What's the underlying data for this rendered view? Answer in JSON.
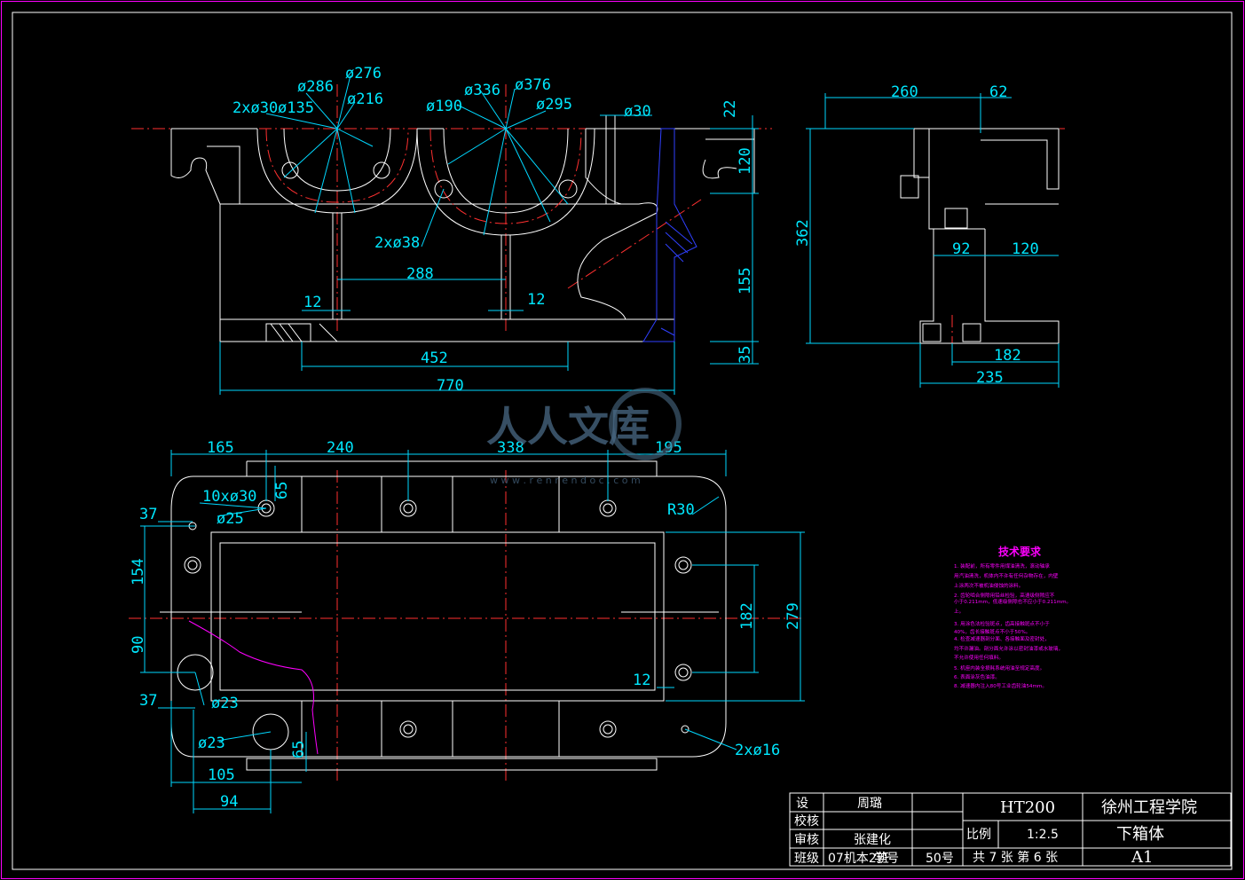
{
  "dims": {
    "d286": "ø286",
    "d276": "ø276",
    "d216": "ø216",
    "d2x30": "2xø30",
    "d135": "ø135",
    "d336": "ø336",
    "d376": "ø376",
    "d190": "ø190",
    "d295": "ø295",
    "d30": "ø30",
    "d22": "22",
    "d120a": "120",
    "d2x38": "2xø38",
    "d288": "288",
    "d12a": "12",
    "d12b": "12",
    "d155": "155",
    "d452": "452",
    "d35": "35",
    "d770": "770",
    "d260": "260",
    "d62": "62",
    "d362": "362",
    "d92": "92",
    "d120b": "120",
    "d182a": "182",
    "d235": "235",
    "d165": "165",
    "d240": "240",
    "d338": "338",
    "d195": "195",
    "d10x30": "10xø30",
    "d65a": "65",
    "d25": "ø25",
    "d37a": "37",
    "d154": "154",
    "d90": "90",
    "d37b": "37",
    "d23a": "ø23",
    "d23b": "ø23",
    "d65b": "65",
    "d105": "105",
    "d94": "94",
    "dR30": "R30",
    "d182b": "182",
    "d279": "279",
    "d12c": "12",
    "d2x16": "2xø16"
  },
  "tech": {
    "title": "技术要求",
    "lines": [
      "1. 装配前，所有零件用煤油清洗，滚动轴承",
      "用汽油清洗，机体内不许有任何杂物存在，内壁",
      "上涂两次不被机油侵蚀的涂料。",
      "2. 齿轮啮合侧隙用铅丝检验，高速级侧隙应不",
      "小于0.211mm，低速级侧隙也不应小于0.211mm。",
      "上。",
      "3. 用涂色法检验斑点，齿高接触斑点不小于",
      "40%，齿长接触斑点不小于50%。",
      "4. 检查减速器剖分面、各接触面及密封处，",
      "均不许漏油。剖分面允许涂以密封油漆或水玻璃，",
      "不允许使用任何填料。",
      "5. 机座内装全损耗系统用油至规定高度。",
      "6. 表面涂灰色油漆。",
      "8. 减速器内注入80号工业齿轮油54mm。"
    ]
  },
  "title_block": {
    "design_label": "设",
    "design_name": "周璐",
    "check_label": "校核",
    "review_label": "审核",
    "review_name": "张建化",
    "class_label": "班级",
    "class_value": "07机本2班",
    "student_no_label": "学号",
    "student_no": "50号",
    "material": "HT200",
    "scale_label": "比例",
    "scale_value": "1:2.5",
    "sheet_info": "共 7 张  第 6 张",
    "school": "徐州工程学院",
    "part_name": "下箱体",
    "size": "A1"
  },
  "watermark": {
    "text": "人人文库",
    "sub": "w w w . r e n r e n d o c . c o m"
  },
  "colors": {
    "frame": "#ff00ff",
    "outline": "#ffffff",
    "centerline": "#ff3030",
    "dimension": "#00d8ff",
    "section": "#3040ff"
  }
}
